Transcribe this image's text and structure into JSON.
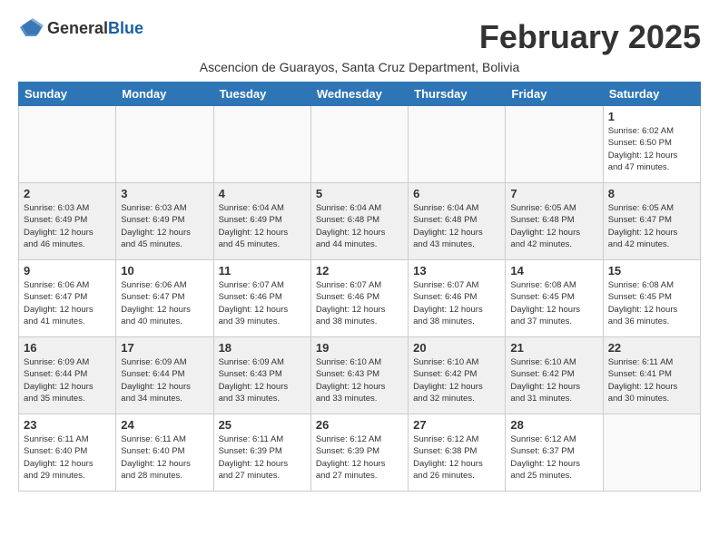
{
  "header": {
    "logo_general": "General",
    "logo_blue": "Blue",
    "month_title": "February 2025",
    "subtitle": "Ascencion de Guarayos, Santa Cruz Department, Bolivia"
  },
  "days_of_week": [
    "Sunday",
    "Monday",
    "Tuesday",
    "Wednesday",
    "Thursday",
    "Friday",
    "Saturday"
  ],
  "weeks": [
    {
      "days": [
        {
          "num": "",
          "info": ""
        },
        {
          "num": "",
          "info": ""
        },
        {
          "num": "",
          "info": ""
        },
        {
          "num": "",
          "info": ""
        },
        {
          "num": "",
          "info": ""
        },
        {
          "num": "",
          "info": ""
        },
        {
          "num": "1",
          "info": "Sunrise: 6:02 AM\nSunset: 6:50 PM\nDaylight: 12 hours\nand 47 minutes."
        }
      ]
    },
    {
      "days": [
        {
          "num": "2",
          "info": "Sunrise: 6:03 AM\nSunset: 6:49 PM\nDaylight: 12 hours\nand 46 minutes."
        },
        {
          "num": "3",
          "info": "Sunrise: 6:03 AM\nSunset: 6:49 PM\nDaylight: 12 hours\nand 45 minutes."
        },
        {
          "num": "4",
          "info": "Sunrise: 6:04 AM\nSunset: 6:49 PM\nDaylight: 12 hours\nand 45 minutes."
        },
        {
          "num": "5",
          "info": "Sunrise: 6:04 AM\nSunset: 6:48 PM\nDaylight: 12 hours\nand 44 minutes."
        },
        {
          "num": "6",
          "info": "Sunrise: 6:04 AM\nSunset: 6:48 PM\nDaylight: 12 hours\nand 43 minutes."
        },
        {
          "num": "7",
          "info": "Sunrise: 6:05 AM\nSunset: 6:48 PM\nDaylight: 12 hours\nand 42 minutes."
        },
        {
          "num": "8",
          "info": "Sunrise: 6:05 AM\nSunset: 6:47 PM\nDaylight: 12 hours\nand 42 minutes."
        }
      ]
    },
    {
      "days": [
        {
          "num": "9",
          "info": "Sunrise: 6:06 AM\nSunset: 6:47 PM\nDaylight: 12 hours\nand 41 minutes."
        },
        {
          "num": "10",
          "info": "Sunrise: 6:06 AM\nSunset: 6:47 PM\nDaylight: 12 hours\nand 40 minutes."
        },
        {
          "num": "11",
          "info": "Sunrise: 6:07 AM\nSunset: 6:46 PM\nDaylight: 12 hours\nand 39 minutes."
        },
        {
          "num": "12",
          "info": "Sunrise: 6:07 AM\nSunset: 6:46 PM\nDaylight: 12 hours\nand 38 minutes."
        },
        {
          "num": "13",
          "info": "Sunrise: 6:07 AM\nSunset: 6:46 PM\nDaylight: 12 hours\nand 38 minutes."
        },
        {
          "num": "14",
          "info": "Sunrise: 6:08 AM\nSunset: 6:45 PM\nDaylight: 12 hours\nand 37 minutes."
        },
        {
          "num": "15",
          "info": "Sunrise: 6:08 AM\nSunset: 6:45 PM\nDaylight: 12 hours\nand 36 minutes."
        }
      ]
    },
    {
      "days": [
        {
          "num": "16",
          "info": "Sunrise: 6:09 AM\nSunset: 6:44 PM\nDaylight: 12 hours\nand 35 minutes."
        },
        {
          "num": "17",
          "info": "Sunrise: 6:09 AM\nSunset: 6:44 PM\nDaylight: 12 hours\nand 34 minutes."
        },
        {
          "num": "18",
          "info": "Sunrise: 6:09 AM\nSunset: 6:43 PM\nDaylight: 12 hours\nand 33 minutes."
        },
        {
          "num": "19",
          "info": "Sunrise: 6:10 AM\nSunset: 6:43 PM\nDaylight: 12 hours\nand 33 minutes."
        },
        {
          "num": "20",
          "info": "Sunrise: 6:10 AM\nSunset: 6:42 PM\nDaylight: 12 hours\nand 32 minutes."
        },
        {
          "num": "21",
          "info": "Sunrise: 6:10 AM\nSunset: 6:42 PM\nDaylight: 12 hours\nand 31 minutes."
        },
        {
          "num": "22",
          "info": "Sunrise: 6:11 AM\nSunset: 6:41 PM\nDaylight: 12 hours\nand 30 minutes."
        }
      ]
    },
    {
      "days": [
        {
          "num": "23",
          "info": "Sunrise: 6:11 AM\nSunset: 6:40 PM\nDaylight: 12 hours\nand 29 minutes."
        },
        {
          "num": "24",
          "info": "Sunrise: 6:11 AM\nSunset: 6:40 PM\nDaylight: 12 hours\nand 28 minutes."
        },
        {
          "num": "25",
          "info": "Sunrise: 6:11 AM\nSunset: 6:39 PM\nDaylight: 12 hours\nand 27 minutes."
        },
        {
          "num": "26",
          "info": "Sunrise: 6:12 AM\nSunset: 6:39 PM\nDaylight: 12 hours\nand 27 minutes."
        },
        {
          "num": "27",
          "info": "Sunrise: 6:12 AM\nSunset: 6:38 PM\nDaylight: 12 hours\nand 26 minutes."
        },
        {
          "num": "28",
          "info": "Sunrise: 6:12 AM\nSunset: 6:37 PM\nDaylight: 12 hours\nand 25 minutes."
        },
        {
          "num": "",
          "info": ""
        }
      ]
    }
  ]
}
